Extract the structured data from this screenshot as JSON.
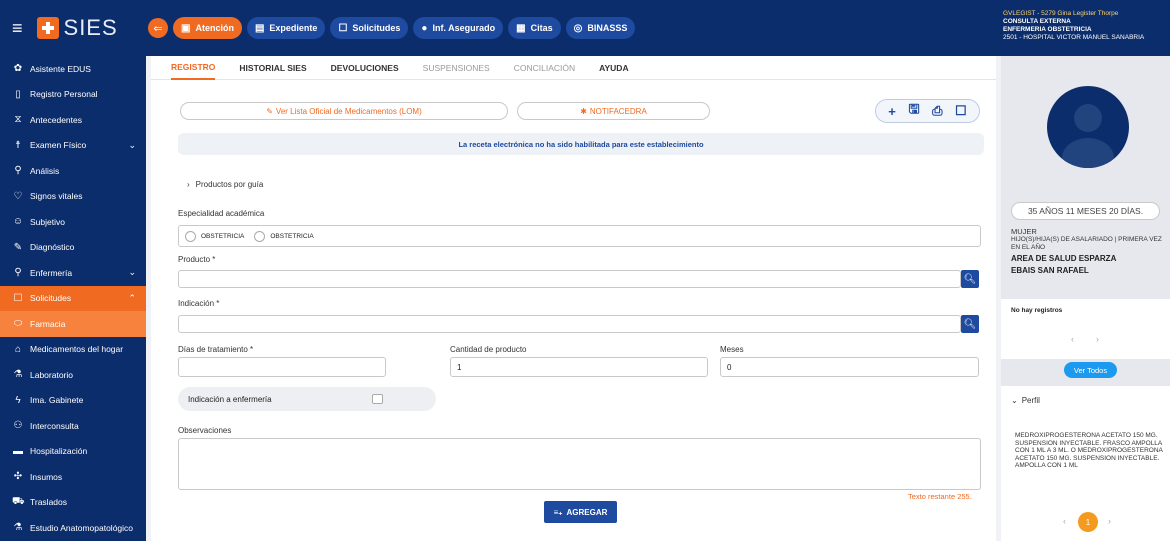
{
  "app": {
    "name": "SIES"
  },
  "header": {
    "nav": [
      {
        "label": "Atención",
        "icon": "clipboard-icon",
        "active": true
      },
      {
        "label": "Expediente",
        "icon": "folder-icon"
      },
      {
        "label": "Solicitudes",
        "icon": "window-icon"
      },
      {
        "label": "Inf. Asegurado",
        "icon": "user-icon"
      },
      {
        "label": "Citas",
        "icon": "calendar-icon"
      },
      {
        "label": "BINASSS",
        "icon": "binasss-icon"
      }
    ],
    "user": {
      "line1": "GVLEGIST - 5279 Gina Legister Thorpe",
      "line2": "CONSULTA EXTERNA",
      "line3": "ENFERMERIA OBSTETRICIA",
      "line4": "2501 - HOSPITAL VICTOR MANUEL SANABRIA"
    }
  },
  "sidebar": {
    "items": [
      {
        "label": "Asistente EDUS",
        "icon": "assistant-icon"
      },
      {
        "label": "Registro Personal",
        "icon": "document-icon"
      },
      {
        "label": "Antecedentes",
        "icon": "hourglass-icon"
      },
      {
        "label": "Examen Físico",
        "icon": "person-icon",
        "chevron": "⌄"
      },
      {
        "label": "Análisis",
        "icon": "search-icon"
      },
      {
        "label": "Signos vitales",
        "icon": "heart-icon"
      },
      {
        "label": "Subjetivo",
        "icon": "face-icon"
      },
      {
        "label": "Diagnóstico",
        "icon": "pen-icon"
      },
      {
        "label": "Enfermería",
        "icon": "location-icon",
        "chevron": "⌄"
      },
      {
        "label": "Solicitudes",
        "icon": "window-icon",
        "chevron": "⌃",
        "state": "active"
      },
      {
        "label": "Farmacia",
        "icon": "pill-icon",
        "state": "sub"
      },
      {
        "label": "Medicamentos del hogar",
        "icon": "home-icon"
      },
      {
        "label": "Laboratorio",
        "icon": "lab-icon"
      },
      {
        "label": "Ima. Gabinete",
        "icon": "bolt-icon"
      },
      {
        "label": "Interconsulta",
        "icon": "group-icon"
      },
      {
        "label": "Hospitalización",
        "icon": "bed-icon"
      },
      {
        "label": "Insumos",
        "icon": "supplies-icon"
      },
      {
        "label": "Traslados",
        "icon": "ambulance-icon"
      },
      {
        "label": "Estudio Anatomopatológico",
        "icon": "microscope-icon"
      }
    ]
  },
  "main": {
    "tabs": [
      {
        "label": "REGISTRO",
        "state": "active"
      },
      {
        "label": "HISTORIAL SIES"
      },
      {
        "label": "DEVOLUCIONES"
      },
      {
        "label": "SUSPENSIONES",
        "state": "disabled"
      },
      {
        "label": "CONCILIACIÓN",
        "state": "disabled"
      },
      {
        "label": "AYUDA"
      }
    ],
    "lom_button": "Ver Lista Oficial de Medicamentos (LOM)",
    "notifacedra_button": "NOTIFACEDRA",
    "notice": "La receta electrónica no ha sido habilitada para este establecimiento",
    "products_by_guide": "Productos por guía",
    "especialidad_label": "Especialidad académica",
    "especialidad_options": [
      "OBSTETRICIA",
      "OBSTETRICIA"
    ],
    "producto_label": "Producto *",
    "producto_value": "",
    "indicacion_label": "Indicación *",
    "indicacion_value": "",
    "dias_label": "Días de tratamiento *",
    "dias_value": "",
    "cantidad_label": "Cantidad de producto",
    "cantidad_value": "1",
    "meses_label": "Meses",
    "meses_value": "0",
    "indicacion_enfermeria": "Indicación a enfermería",
    "observaciones_label": "Observaciones",
    "observaciones_value": "",
    "remaining": "Texto restante 255.",
    "add_button": "AGREGAR"
  },
  "patient": {
    "age": "35 AÑOS 11 MESES 20 DÍAS.",
    "sex": "MUJER",
    "relation": "HIJO(S)/HIJA(S) DE ASALARIADO | PRIMERA VEZ EN EL AÑO",
    "area": "AREA DE SALUD ESPARZA",
    "ebais": "EBAIS SAN RAFAEL",
    "no_records": "No hay registros",
    "ver_todos": "Ver Todos",
    "perfil_label": "Perfil",
    "perfil_text": "MEDROXIPROGESTERONA ACETATO 150 MG. SUSPENSION INYECTABLE. FRASCO AMPOLLA CON 1 ML A 3 ML. O MEDROXIPROGESTERONA ACETATO 150 MG. SUSPENSION INYECTABLE. AMPOLLA CON 1 ML",
    "page": "1"
  },
  "colors": {
    "navy": "#0c2d6b",
    "accent": "#f06a22",
    "blue": "#1e4aa0",
    "light_blue": "#1b9af0"
  }
}
